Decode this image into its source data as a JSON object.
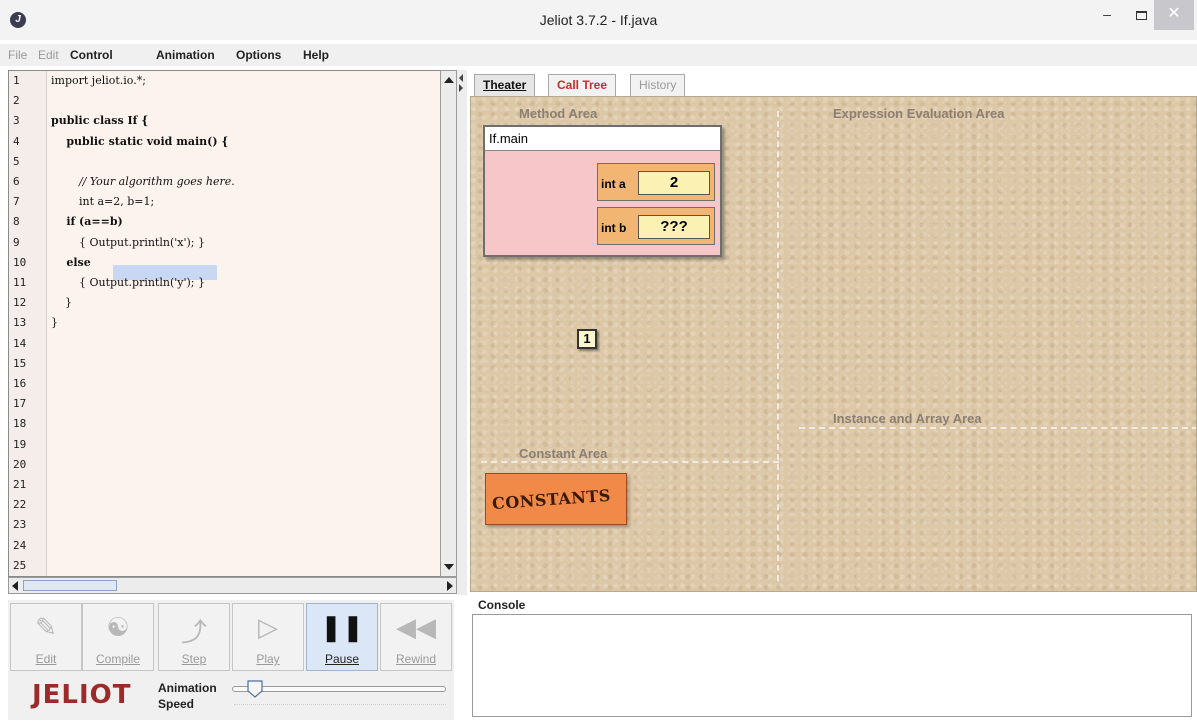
{
  "window": {
    "title": "Jeliot 3.7.2 - If.java",
    "app_icon": "J",
    "minimize": "–",
    "close": "✕"
  },
  "menu": [
    "File",
    "Edit",
    "Control",
    "Animation",
    "Options",
    "Help"
  ],
  "editor": {
    "line_numbers": [
      "1",
      "2",
      "3",
      "4",
      "5",
      "6",
      "7",
      "8",
      "9",
      "10",
      "11",
      "12",
      "13",
      "14",
      "15",
      "16",
      "17",
      "18",
      "19",
      "20",
      "21",
      "22",
      "23",
      "24",
      "25"
    ],
    "code": [
      "import jeliot.io.*;",
      "",
      "public class If {",
      "    public static void main() {",
      "",
      "        // Your algorithm goes here.",
      "        int a=2, b=1;",
      "    if (a==b)",
      "        { Output.println('x'); }",
      "    else",
      "        { Output.println('y'); }",
      "    }",
      "}"
    ],
    "highlighted_line": 7,
    "highlight_color": "#c9d8f2",
    "background_color": "#fdf3ee"
  },
  "tabs": [
    {
      "label": "Theater",
      "active": true
    },
    {
      "label": "Call Tree",
      "active": false
    },
    {
      "label": "History",
      "active": false
    }
  ],
  "theater": {
    "method_area_label": "Method Area",
    "expression_area_label": "Expression Evaluation Area",
    "instance_area_label": "Instance and Array Area",
    "constant_area_label": "Constant Area",
    "frame": {
      "title": "If.main",
      "variables": [
        {
          "label": "int a",
          "value": "2"
        },
        {
          "label": "int b",
          "value": "???"
        }
      ]
    },
    "literal_value": "1",
    "constants_label": "CONSTANTS",
    "background_color": "#dcc7a6"
  },
  "controls": {
    "buttons": [
      {
        "label": "Edit",
        "icon": "edit-icon",
        "glyph": "✎",
        "active": false
      },
      {
        "label": "Compile",
        "icon": "compile-icon",
        "glyph": "☯",
        "active": false
      },
      {
        "label": "Step",
        "icon": "step-icon",
        "glyph": "⤴",
        "active": false
      },
      {
        "label": "Play",
        "icon": "play-icon",
        "glyph": "▷",
        "active": false
      },
      {
        "label": "Pause",
        "icon": "pause-icon",
        "glyph": "❚❚",
        "active": true
      },
      {
        "label": "Rewind",
        "icon": "rewind-icon",
        "glyph": "◀◀",
        "active": false
      }
    ],
    "logo": "JELIOT",
    "speed_label_1": "Animation",
    "speed_label_2": "Speed",
    "speed_level_fraction": 0.1
  },
  "console": {
    "label": "Console",
    "text": ""
  }
}
